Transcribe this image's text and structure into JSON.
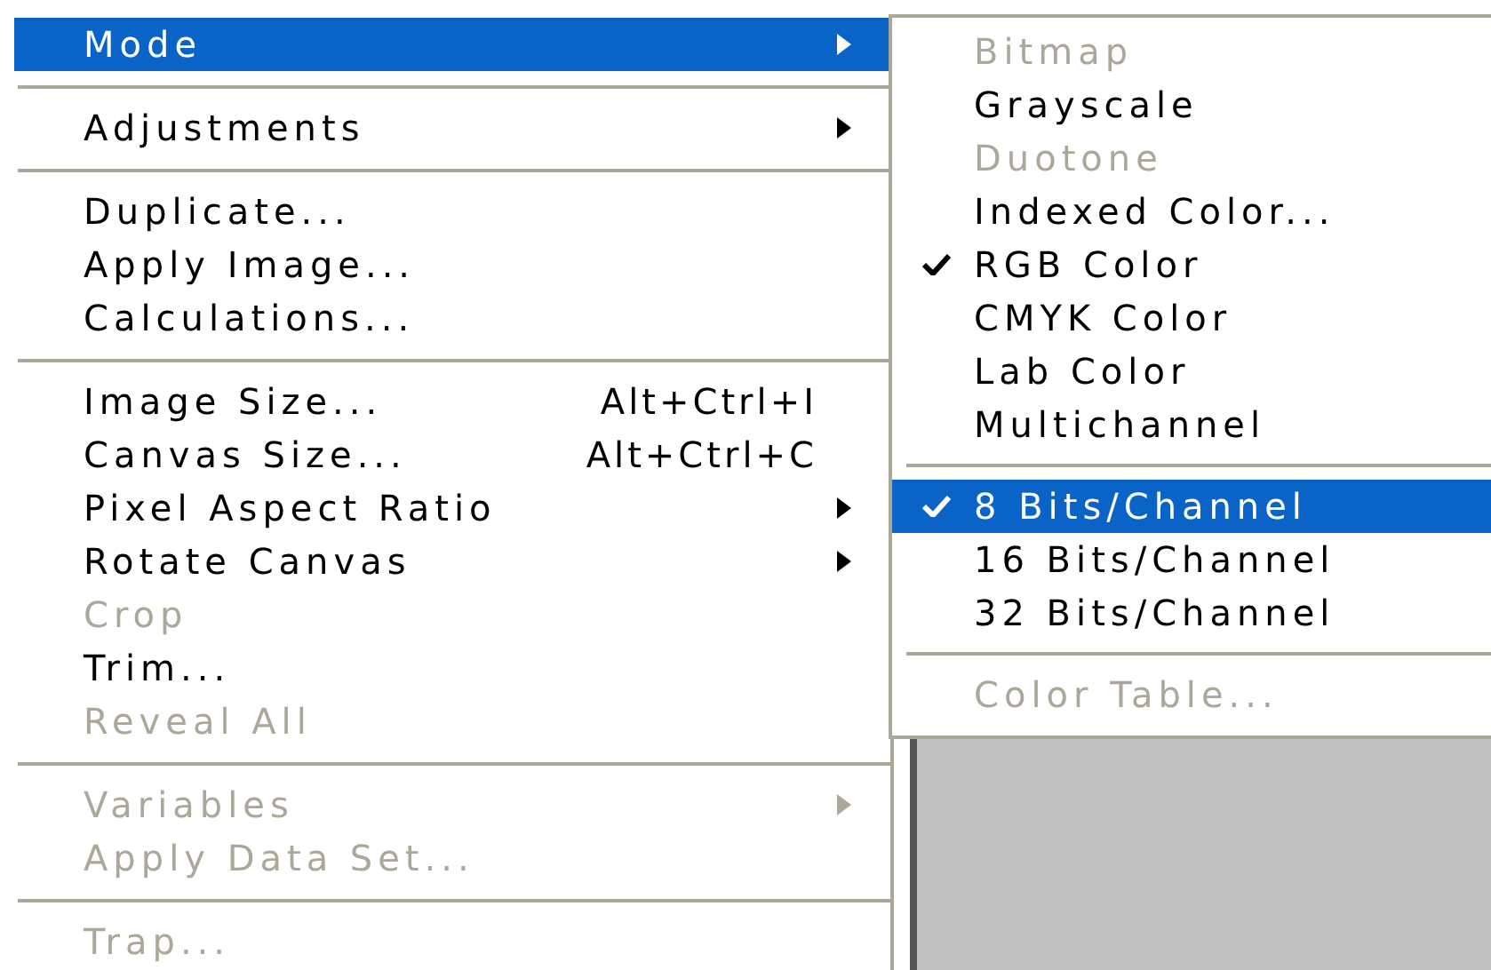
{
  "image_menu": {
    "items": [
      {
        "kind": "item",
        "label": "Mode",
        "submenu": true,
        "disabled": false,
        "selected": true
      },
      {
        "kind": "separator"
      },
      {
        "kind": "item",
        "label": "Adjustments",
        "submenu": true,
        "disabled": false,
        "selected": false
      },
      {
        "kind": "separator"
      },
      {
        "kind": "item",
        "label": "Duplicate...",
        "submenu": false,
        "disabled": false,
        "selected": false
      },
      {
        "kind": "item",
        "label": "Apply Image...",
        "submenu": false,
        "disabled": false,
        "selected": false
      },
      {
        "kind": "item",
        "label": "Calculations...",
        "submenu": false,
        "disabled": false,
        "selected": false
      },
      {
        "kind": "separator"
      },
      {
        "kind": "item",
        "label": "Image Size...",
        "shortcut": "Alt+Ctrl+I",
        "submenu": false,
        "disabled": false,
        "selected": false
      },
      {
        "kind": "item",
        "label": "Canvas Size...",
        "shortcut": "Alt+Ctrl+C",
        "submenu": false,
        "disabled": false,
        "selected": false
      },
      {
        "kind": "item",
        "label": "Pixel Aspect Ratio",
        "submenu": true,
        "disabled": false,
        "selected": false
      },
      {
        "kind": "item",
        "label": "Rotate Canvas",
        "submenu": true,
        "disabled": false,
        "selected": false
      },
      {
        "kind": "item",
        "label": "Crop",
        "submenu": false,
        "disabled": true,
        "selected": false
      },
      {
        "kind": "item",
        "label": "Trim...",
        "submenu": false,
        "disabled": false,
        "selected": false
      },
      {
        "kind": "item",
        "label": "Reveal All",
        "submenu": false,
        "disabled": true,
        "selected": false
      },
      {
        "kind": "separator"
      },
      {
        "kind": "item",
        "label": "Variables",
        "submenu": true,
        "disabled": true,
        "selected": false
      },
      {
        "kind": "item",
        "label": "Apply Data Set...",
        "submenu": false,
        "disabled": true,
        "selected": false
      },
      {
        "kind": "separator"
      },
      {
        "kind": "item",
        "label": "Trap...",
        "submenu": false,
        "disabled": true,
        "selected": false
      }
    ]
  },
  "mode_submenu": {
    "items": [
      {
        "kind": "item",
        "label": "Bitmap",
        "checked": false,
        "disabled": true,
        "selected": false
      },
      {
        "kind": "item",
        "label": "Grayscale",
        "checked": false,
        "disabled": false,
        "selected": false
      },
      {
        "kind": "item",
        "label": "Duotone",
        "checked": false,
        "disabled": true,
        "selected": false
      },
      {
        "kind": "item",
        "label": "Indexed Color...",
        "checked": false,
        "disabled": false,
        "selected": false
      },
      {
        "kind": "item",
        "label": "RGB Color",
        "checked": true,
        "disabled": false,
        "selected": false
      },
      {
        "kind": "item",
        "label": "CMYK Color",
        "checked": false,
        "disabled": false,
        "selected": false
      },
      {
        "kind": "item",
        "label": "Lab Color",
        "checked": false,
        "disabled": false,
        "selected": false
      },
      {
        "kind": "item",
        "label": "Multichannel",
        "checked": false,
        "disabled": false,
        "selected": false
      },
      {
        "kind": "separator"
      },
      {
        "kind": "item",
        "label": "8 Bits/Channel",
        "checked": true,
        "disabled": false,
        "selected": true
      },
      {
        "kind": "item",
        "label": "16 Bits/Channel",
        "checked": false,
        "disabled": false,
        "selected": false
      },
      {
        "kind": "item",
        "label": "32 Bits/Channel",
        "checked": false,
        "disabled": false,
        "selected": false
      },
      {
        "kind": "separator"
      },
      {
        "kind": "item",
        "label": "Color Table...",
        "checked": false,
        "disabled": true,
        "selected": false
      }
    ]
  }
}
